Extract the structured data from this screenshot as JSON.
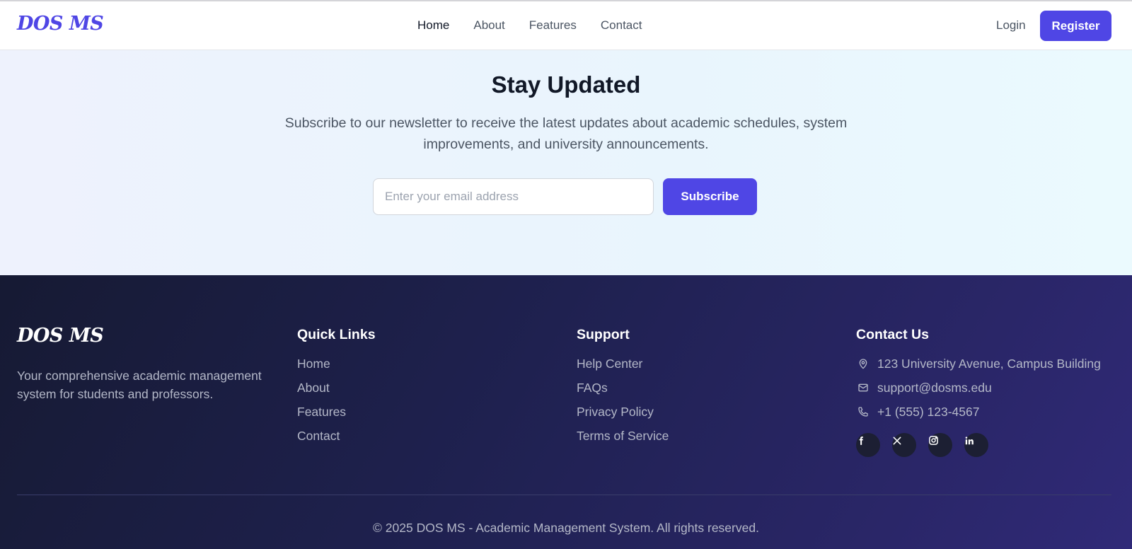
{
  "brand": {
    "name": "DOS MS",
    "accent": "#4f46e5"
  },
  "nav": {
    "links": [
      {
        "label": "Home",
        "active": true
      },
      {
        "label": "About",
        "active": false
      },
      {
        "label": "Features",
        "active": false
      },
      {
        "label": "Contact",
        "active": false
      }
    ],
    "login_label": "Login",
    "register_label": "Register"
  },
  "newsletter": {
    "title": "Stay Updated",
    "description": "Subscribe to our newsletter to receive the latest updates about academic schedules, system improvements, and university announcements.",
    "email_placeholder": "Enter your email address",
    "subscribe_label": "Subscribe"
  },
  "footer": {
    "description": "Your comprehensive academic management system for students and professors.",
    "quick_links": {
      "title": "Quick Links",
      "items": [
        "Home",
        "About",
        "Features",
        "Contact"
      ]
    },
    "support": {
      "title": "Support",
      "items": [
        "Help Center",
        "FAQs",
        "Privacy Policy",
        "Terms of Service"
      ]
    },
    "contact": {
      "title": "Contact Us",
      "items": [
        {
          "icon": "map-pin-icon",
          "text": "123 University Avenue, Campus Building"
        },
        {
          "icon": "mail-icon",
          "text": "support@dosms.edu"
        },
        {
          "icon": "phone-icon",
          "text": "+1 (555) 123-4567"
        }
      ],
      "socials": [
        "facebook-icon",
        "x-icon",
        "instagram-icon",
        "linkedin-icon"
      ]
    },
    "copyright": "© 2025 DOS MS - Academic Management System. All rights reserved."
  }
}
